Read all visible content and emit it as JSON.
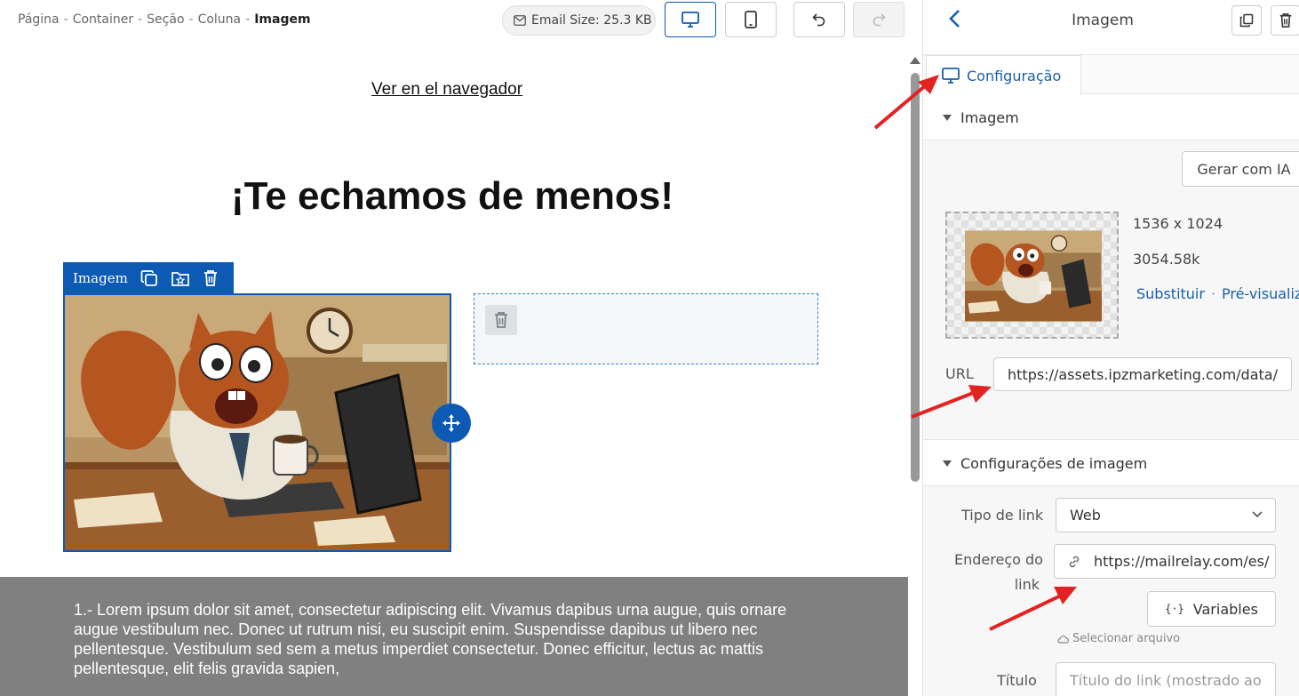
{
  "breadcrumb": {
    "items": [
      "Página",
      "Container",
      "Seção",
      "Coluna"
    ],
    "current": "Imagem",
    "separator": "-"
  },
  "toolbar": {
    "email_size": "Email Size: 25.3 KB",
    "desktop_icon": "monitor-icon",
    "mobile_icon": "smartphone-icon",
    "undo_icon": "undo-icon",
    "redo_icon": "redo-icon"
  },
  "canvas": {
    "browser_link": "Ver en el navegador",
    "headline": "¡Te echamos de menos!",
    "image_toolbar_label": "Imagem",
    "paragraph": "1.- Lorem ipsum dolor sit amet, consectetur adipiscing elit. Vivamus dapibus urna augue, quis ornare augue vestibulum nec. Donec ut rutrum nisi, eu suscipit enim. Suspendisse dapibus ut libero nec pellentesque. Vestibulum sed sem a metus imperdiet consectetur. Donec efficitur, lectus ac mattis pellentesque, elit felis gravida sapien,"
  },
  "panel": {
    "title": "Imagem",
    "tab_label": "Configuração",
    "section_image": "Imagem",
    "generate_button": "Gerar com IA",
    "dimensions": "1536 x 1024",
    "file_size": "3054.58k",
    "replace_link": "Substituir",
    "preview_link": "Pré-visualiz",
    "url_label": "URL",
    "url_value": "https://assets.ipzmarketing.com/data/",
    "section_settings": "Configurações de imagem",
    "link_type_label": "Tipo de link",
    "link_type_value": "Web",
    "link_address_label_1": "Endereço do",
    "link_address_label_2": "link",
    "link_address_value": "https://mailrelay.com/es/",
    "variables_button": "Variables",
    "select_file": "Selecionar arquivo",
    "title_label": "Título",
    "title_placeholder": "Título do link (mostrado ao"
  },
  "colors": {
    "accent": "#0d5ab4",
    "link": "#1a5fa8",
    "annotation_arrow": "#e32222",
    "gray_section": "#808080"
  }
}
